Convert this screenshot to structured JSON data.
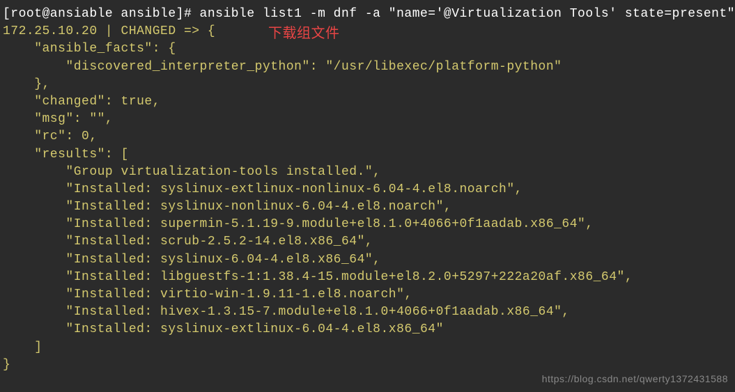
{
  "terminal": {
    "prompt": "[root@ansiable ansible]# ",
    "command": "ansible list1 -m dnf -a \"name='@Virtualization Tools' state=present\"",
    "host_status": "172.25.10.20 | CHANGED => {",
    "facts_open": "    \"ansible_facts\": {",
    "interpreter": "        \"discovered_interpreter_python\": \"/usr/libexec/platform-python\"",
    "facts_close": "    },",
    "changed": "    \"changed\": true,",
    "msg": "    \"msg\": \"\",",
    "rc": "    \"rc\": 0,",
    "results_open": "    \"results\": [",
    "r0": "        \"Group virtualization-tools installed.\",",
    "r1": "        \"Installed: syslinux-extlinux-nonlinux-6.04-4.el8.noarch\",",
    "r2": "        \"Installed: syslinux-nonlinux-6.04-4.el8.noarch\",",
    "r3": "        \"Installed: supermin-5.1.19-9.module+el8.1.0+4066+0f1aadab.x86_64\",",
    "r4": "        \"Installed: scrub-2.5.2-14.el8.x86_64\",",
    "r5": "        \"Installed: syslinux-6.04-4.el8.x86_64\",",
    "r6": "        \"Installed: libguestfs-1:1.38.4-15.module+el8.2.0+5297+222a20af.x86_64\",",
    "r7": "        \"Installed: virtio-win-1.9.11-1.el8.noarch\",",
    "r8": "        \"Installed: hivex-1.3.15-7.module+el8.1.0+4066+0f1aadab.x86_64\",",
    "r9": "        \"Installed: syslinux-extlinux-6.04-4.el8.x86_64\"",
    "results_close": "    ]",
    "json_close": "}"
  },
  "annotation": "下载组文件",
  "watermark": "https://blog.csdn.net/qwerty1372431588"
}
